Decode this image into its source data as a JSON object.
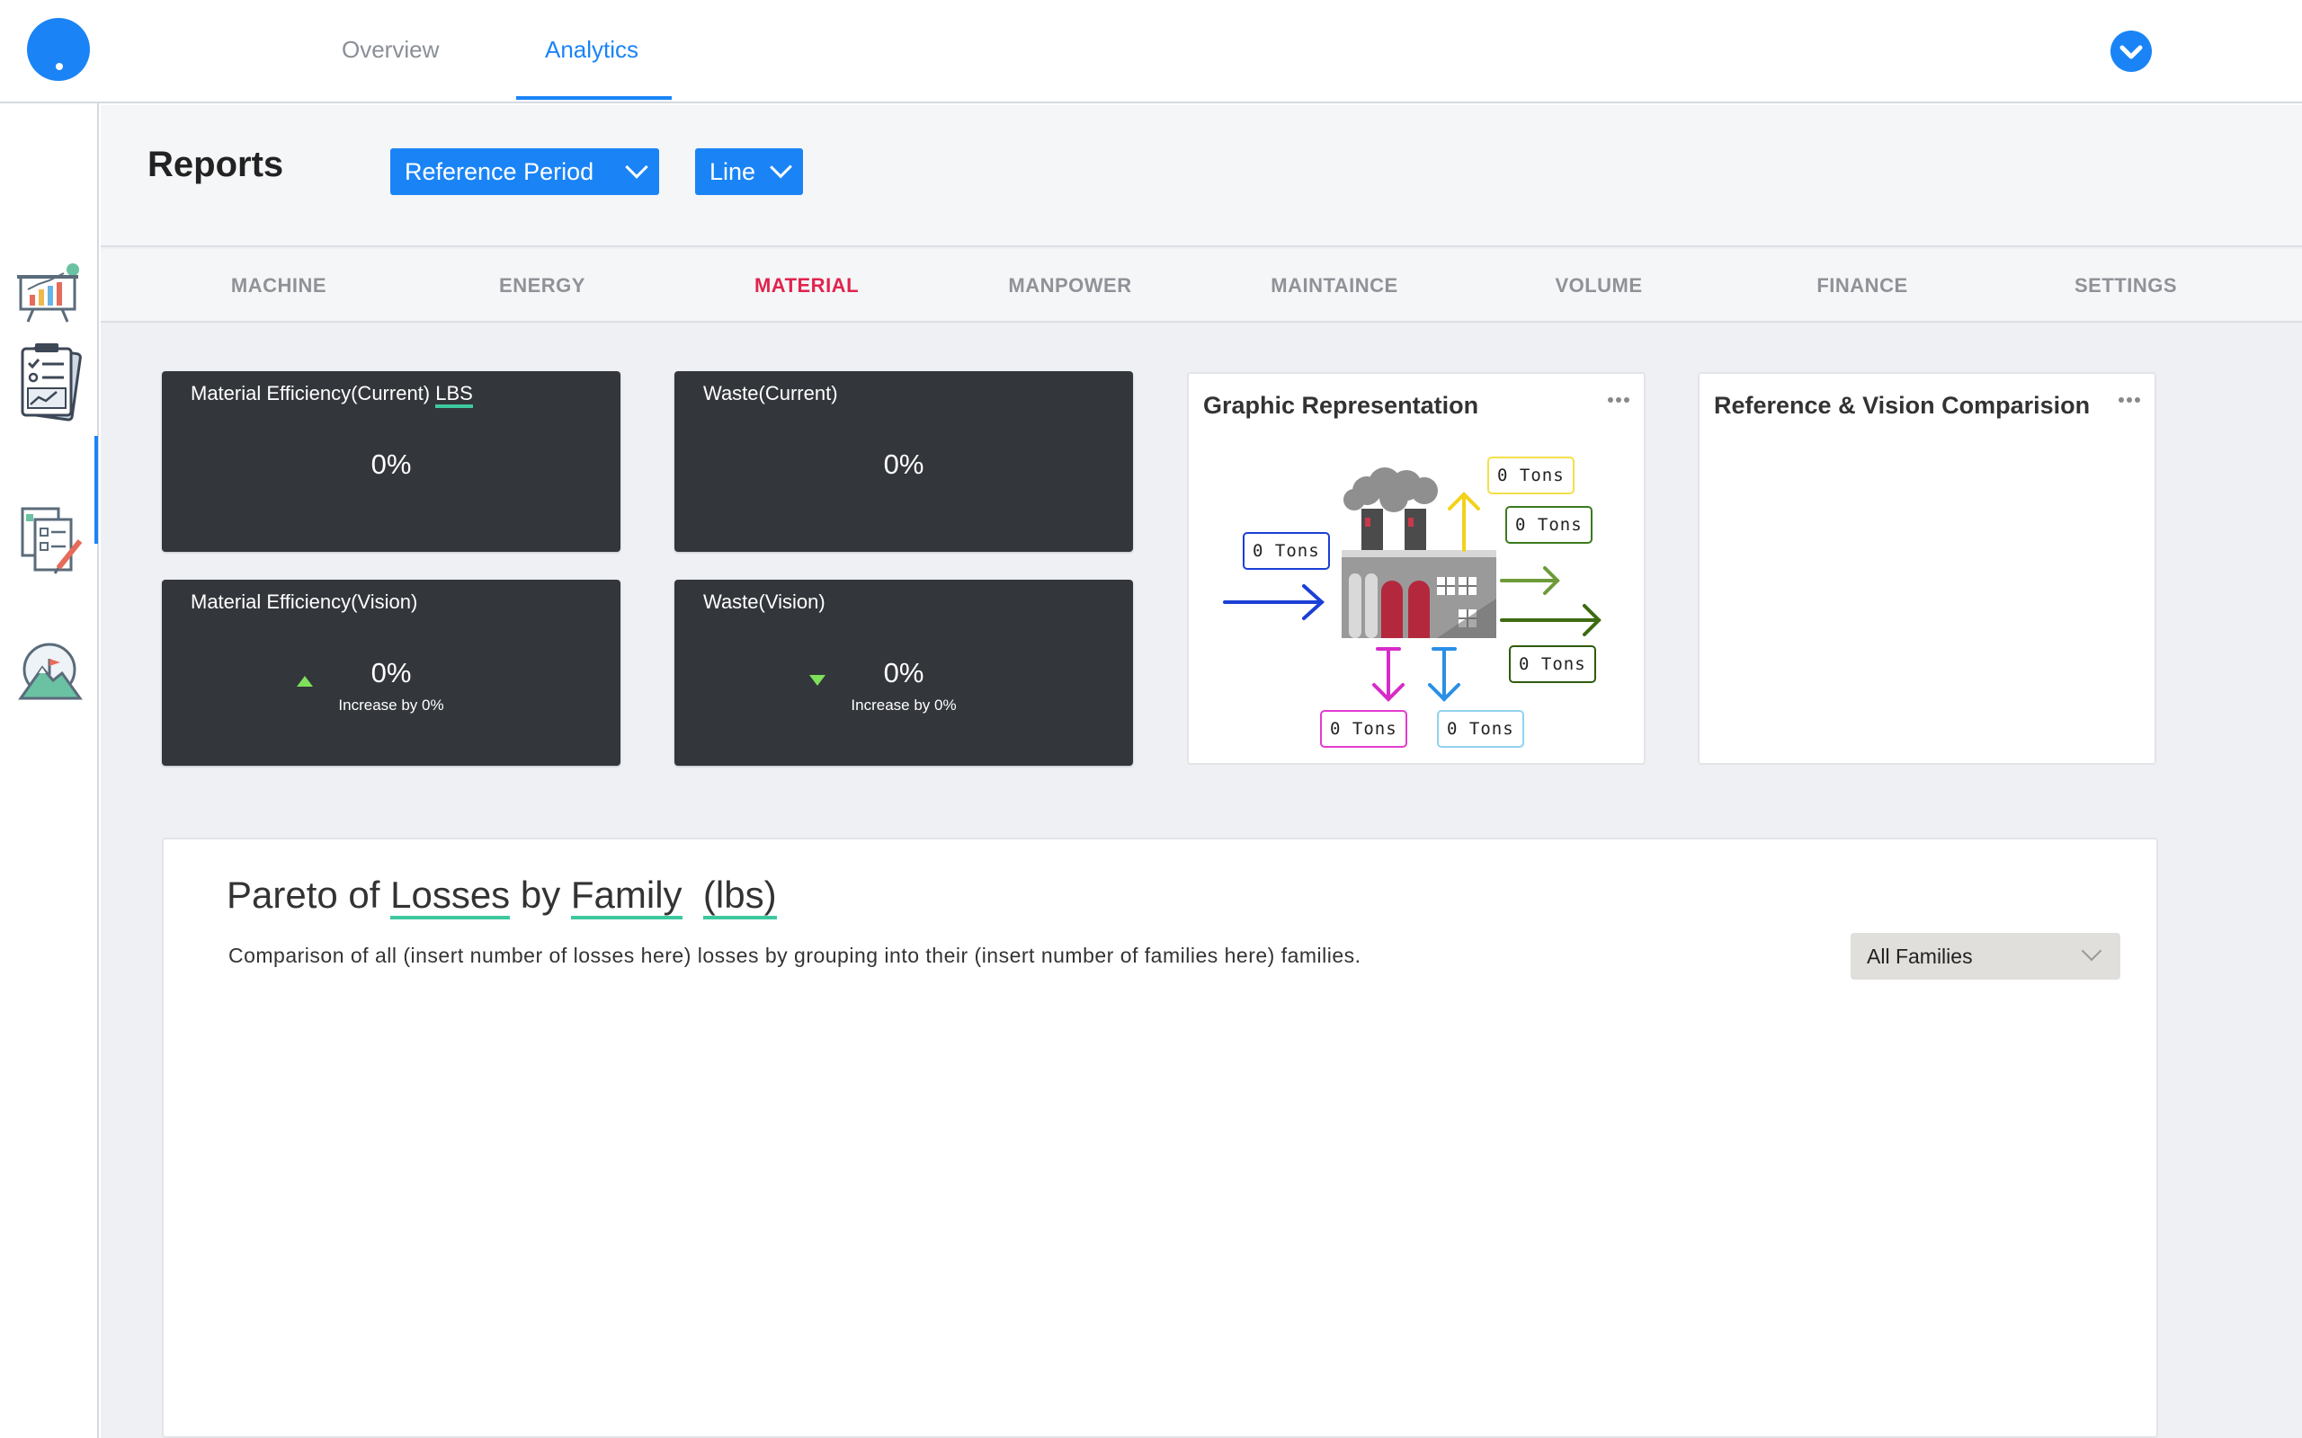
{
  "header": {
    "tabs": [
      {
        "label": "Overview",
        "active": false
      },
      {
        "label": "Analytics",
        "active": true
      }
    ],
    "user_menu_icon": "chevron-down-circle-icon",
    "accent_color": "#1a84f6"
  },
  "sidebar": {
    "items": [
      {
        "icon": "presentation-chart-icon",
        "active": false
      },
      {
        "icon": "report-checklist-icon",
        "active": true
      },
      {
        "icon": "edit-checklist-icon",
        "active": false
      },
      {
        "icon": "vision-mountain-icon",
        "active": false
      }
    ]
  },
  "reports": {
    "title": "Reports",
    "period_dropdown": "Reference Period",
    "chart_type_dropdown": "Line"
  },
  "categories": [
    {
      "label": "MACHINE",
      "active": false
    },
    {
      "label": "ENERGY",
      "active": false
    },
    {
      "label": "MATERIAL",
      "active": true
    },
    {
      "label": "MANPOWER",
      "active": false
    },
    {
      "label": "MAINTAINCE",
      "active": false
    },
    {
      "label": "VOLUME",
      "active": false
    },
    {
      "label": "FINANCE",
      "active": false
    },
    {
      "label": "SETTINGS",
      "active": false
    }
  ],
  "kpis": {
    "material_current": {
      "title": "Material Efficiency(Current)",
      "unit": "LBS",
      "value": "0%"
    },
    "waste_current": {
      "title": "Waste(Current)",
      "value": "0%"
    },
    "material_vision": {
      "title": "Material Efficiency(Vision)",
      "value": "0%",
      "sub": "Increase by 0%",
      "trend": "up"
    },
    "waste_vision": {
      "title": "Waste(Vision)",
      "value": "0%",
      "sub": "Increase by 0%",
      "trend": "down"
    }
  },
  "graphic": {
    "title": "Graphic Representation",
    "tags": {
      "input": "0 Tons",
      "top_yellow": "0 Tons",
      "right_green_top": "0 Tons",
      "right_green_bottom": "0 Tons",
      "bottom_magenta": "0 Tons",
      "bottom_blue": "0 Tons"
    }
  },
  "comparison": {
    "title": "Reference & Vision Comparision"
  },
  "pareto": {
    "title_parts": [
      "Pareto of ",
      "Losses",
      " by ",
      "Family",
      "  ",
      "(lbs)"
    ],
    "description": "Comparison of all (insert number of losses here) losses by grouping into their (insert number of families here) families.",
    "family_dropdown": "All Families"
  }
}
